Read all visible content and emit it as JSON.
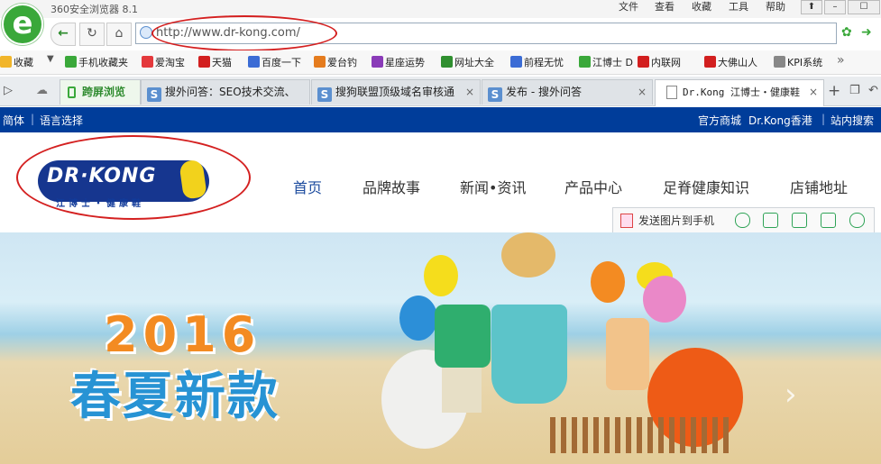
{
  "browser": {
    "title": "360安全浏览器 8.1",
    "menu": [
      "文件",
      "查看",
      "收藏",
      "工具",
      "帮助"
    ],
    "address_url": "http://www.dr-kong.com/"
  },
  "bookmarks": [
    {
      "label": "收藏",
      "icon": "star-icon",
      "color": "#f1b52a"
    },
    {
      "label": "手机收藏夹",
      "icon": "phone-icon",
      "color": "#3aa83a"
    },
    {
      "label": "爱淘宝",
      "icon": "taobao-icon",
      "color": "#e4393c"
    },
    {
      "label": "天猫",
      "icon": "tmall-icon",
      "color": "#d21f1f"
    },
    {
      "label": "百度一下",
      "icon": "baidu-icon",
      "color": "#3b6cd5"
    },
    {
      "label": "爱台钓",
      "icon": "grid-icon",
      "color": "#e57c1e"
    },
    {
      "label": "星座运势",
      "icon": "star-icon",
      "color": "#8a3bb8"
    },
    {
      "label": "网址大全",
      "icon": "plus-icon",
      "color": "#2f8f2f"
    },
    {
      "label": "前程无忧",
      "icon": "hand-icon",
      "color": "#3b6cd5"
    },
    {
      "label": "江博士 D",
      "icon": "foot-icon",
      "color": "#3aa83a"
    },
    {
      "label": "内联网",
      "icon": "intranet-icon",
      "color": "#d21f1f"
    },
    {
      "label": "大佛山人",
      "icon": "flag-icon",
      "color": "#d21f1f"
    },
    {
      "label": "KPI系统",
      "icon": "page-icon",
      "color": "#888888"
    }
  ],
  "tabs": [
    {
      "label": "跨屏浏览",
      "active": false
    },
    {
      "label": "搜外问答：SEO技术交流、",
      "active": false
    },
    {
      "label": "搜狗联盟顶级域名审核通",
      "active": false
    },
    {
      "label": "发布 - 搜外问答",
      "active": false
    },
    {
      "label": "Dr.Kong 江博士・健康鞋",
      "active": true
    }
  ],
  "site": {
    "topbar_left": [
      "简体",
      "语言选择"
    ],
    "topbar_right": [
      "官方商城",
      "Dr.Kong香港",
      "站内搜索"
    ],
    "logo_text": "DR·KONG",
    "logo_sub": "江博士・健康鞋",
    "nav": [
      "首页",
      "品牌故事",
      "新闻•资讯",
      "产品中心",
      "足脊健康知识",
      "店铺地址"
    ],
    "share_label": "发送图片到手机",
    "banner_year": "2016",
    "banner_slogan": "春夏新款"
  },
  "colors": {
    "site_topbar": "#003d9a",
    "nav_active": "#1c4b9e",
    "annotation_circle": "#d42020",
    "browser_green": "#3aa83a"
  }
}
